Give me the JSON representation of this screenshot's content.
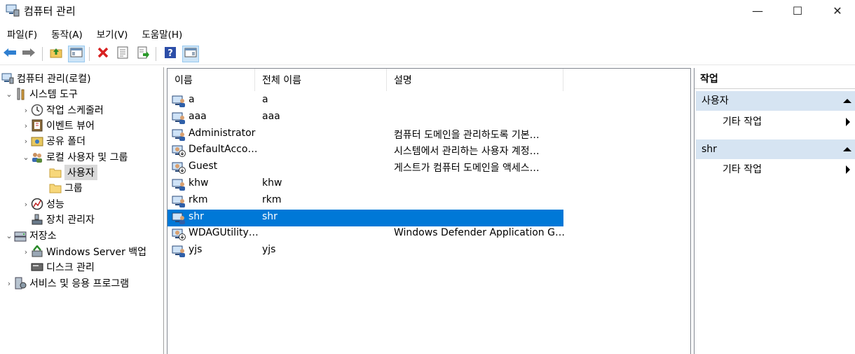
{
  "window": {
    "title": "컴퓨터 관리",
    "minimize": "—",
    "maximize": "☐",
    "close": "✕"
  },
  "menu": [
    "파일(F)",
    "동작(A)",
    "보기(V)",
    "도움말(H)"
  ],
  "tree": {
    "root": "컴퓨터 관리(로컬)",
    "system_tools": "시스템 도구",
    "task_scheduler": "작업 스케줄러",
    "event_viewer": "이벤트 뷰어",
    "shared_folders": "공유 폴더",
    "local_users_groups": "로컬 사용자 및 그룹",
    "users": "사용자",
    "groups": "그룹",
    "performance": "성능",
    "device_manager": "장치 관리자",
    "storage": "저장소",
    "windows_server_backup": "Windows Server 백업",
    "disk_management": "디스크 관리",
    "services_apps": "서비스 및 응용 프로그램"
  },
  "list": {
    "headers": {
      "name": "이름",
      "full_name": "전체 이름",
      "description": "설명"
    },
    "rows": [
      {
        "name": "a",
        "full_name": "a",
        "description": "",
        "disabled": false,
        "selected": false
      },
      {
        "name": "aaa",
        "full_name": "aaa",
        "description": "",
        "disabled": false,
        "selected": false
      },
      {
        "name": "Administrator",
        "full_name": "",
        "description": "컴퓨터 도메인을 관리하도록 기본…",
        "disabled": false,
        "selected": false
      },
      {
        "name": "DefaultAcco…",
        "full_name": "",
        "description": "시스템에서 관리하는 사용자 계정…",
        "disabled": true,
        "selected": false
      },
      {
        "name": "Guest",
        "full_name": "",
        "description": "게스트가 컴퓨터 도메인을 액세스…",
        "disabled": true,
        "selected": false
      },
      {
        "name": "khw",
        "full_name": "khw",
        "description": "",
        "disabled": false,
        "selected": false
      },
      {
        "name": "rkm",
        "full_name": "rkm",
        "description": "",
        "disabled": false,
        "selected": false
      },
      {
        "name": "shr",
        "full_name": "shr",
        "description": "",
        "disabled": false,
        "selected": true
      },
      {
        "name": "WDAGUtility…",
        "full_name": "",
        "description": "Windows Defender Application G…",
        "disabled": true,
        "selected": false
      },
      {
        "name": "yjs",
        "full_name": "yjs",
        "description": "",
        "disabled": false,
        "selected": false
      }
    ]
  },
  "actions": {
    "title": "작업",
    "section1": "사용자",
    "section1_item": "기타 작업",
    "section2": "shr",
    "section2_item": "기타 작업"
  },
  "colors": {
    "selection": "#0078d7",
    "action_section": "#d6e4f2",
    "tree_selected": "#d9d9d9"
  }
}
